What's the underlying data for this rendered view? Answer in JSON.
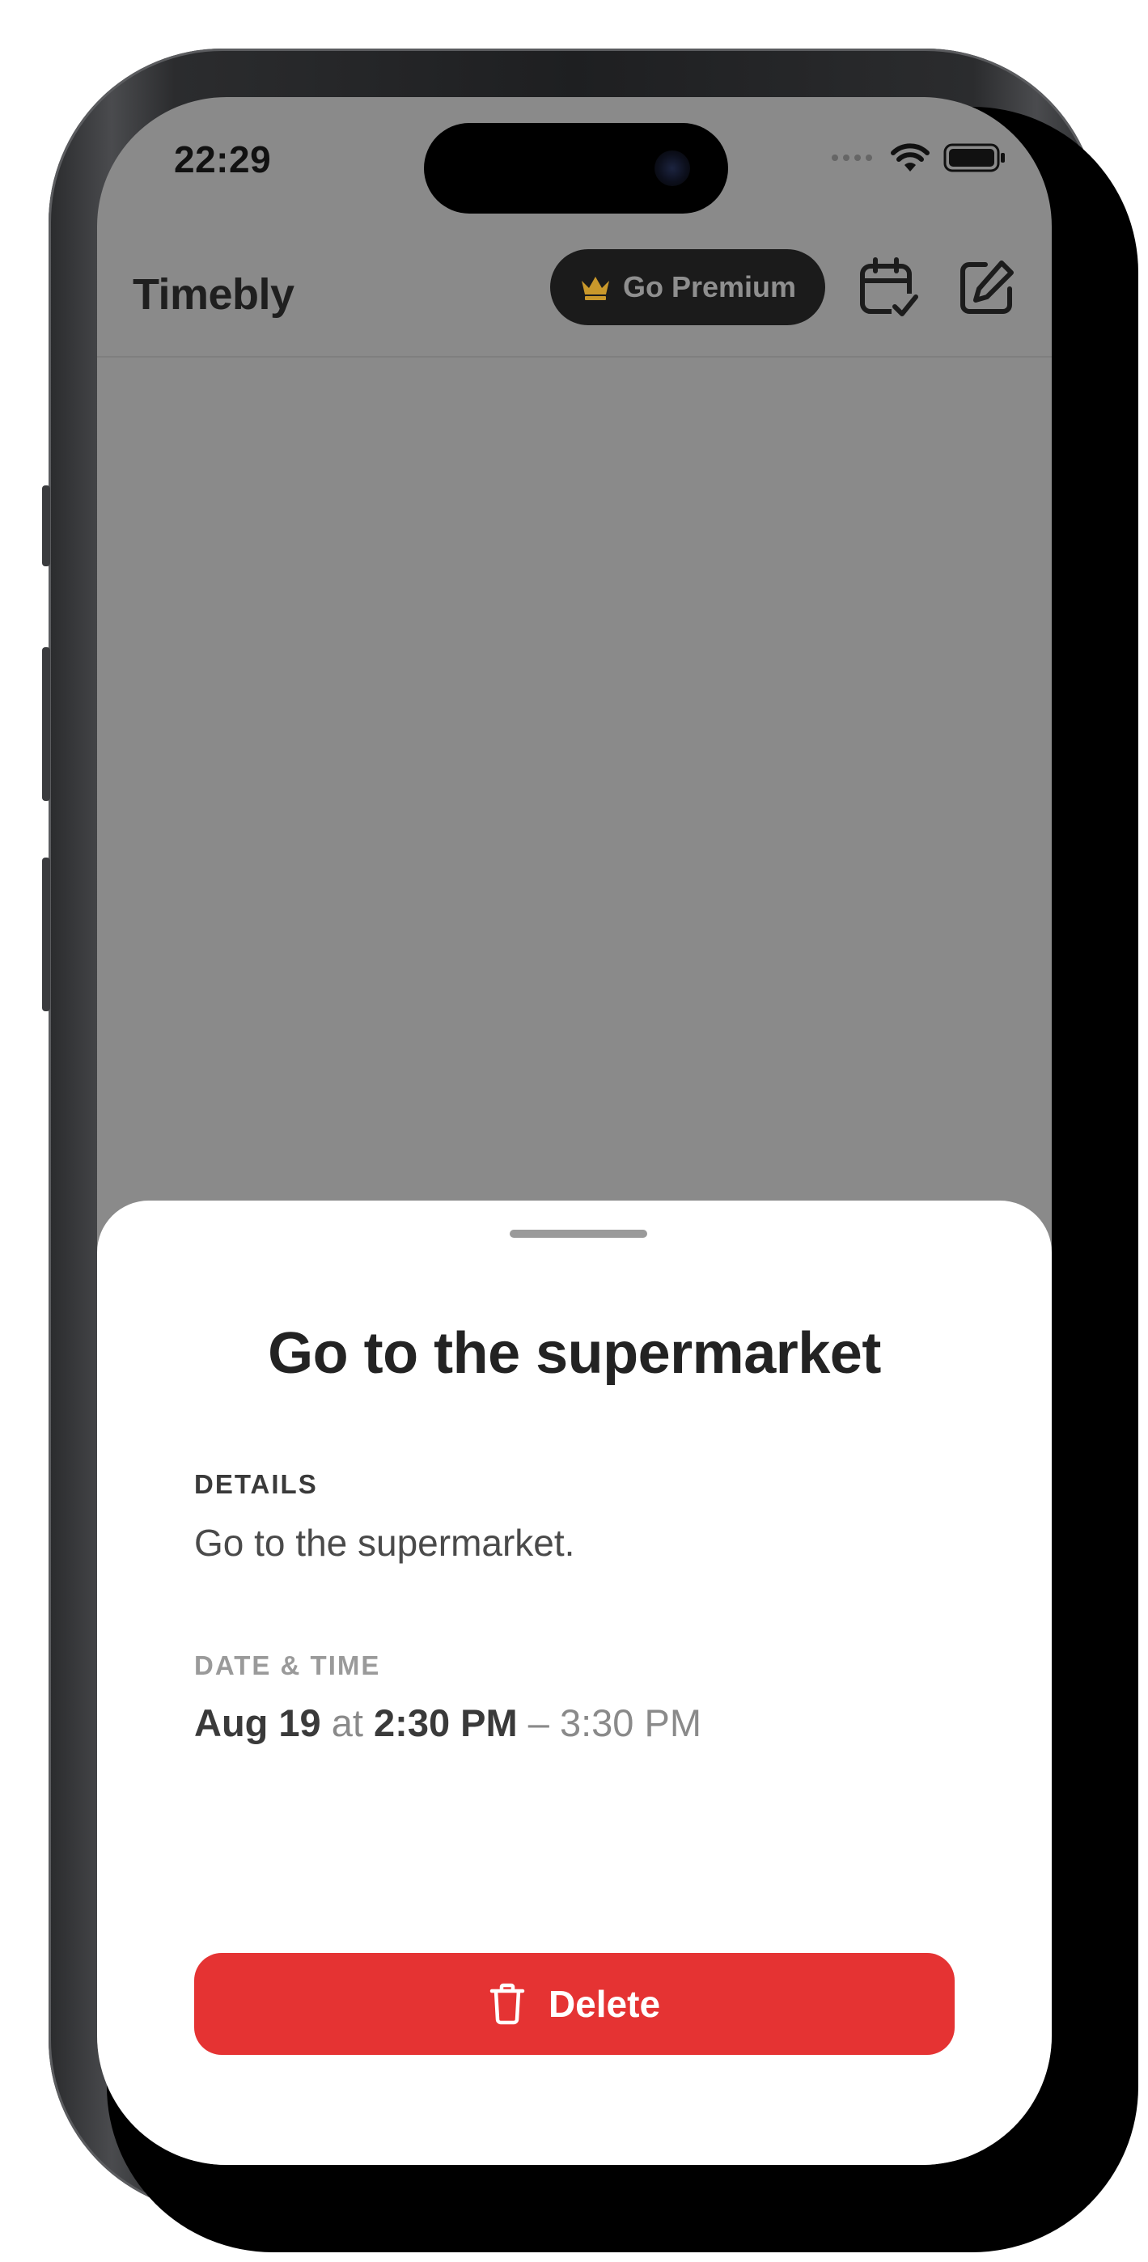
{
  "status_bar": {
    "time": "22:29"
  },
  "nav": {
    "app_title": "Timebly",
    "premium_label": "Go Premium",
    "icons": [
      "crown-icon",
      "calendar-check-icon",
      "compose-icon"
    ]
  },
  "sheet": {
    "title": "Go to the supermarket",
    "details_label": "DETAILS",
    "details_text": "Go to the supermarket.",
    "datetime_label": "DATE & TIME",
    "date": "Aug 19",
    "at": "at",
    "start_time": "2:30 PM",
    "dash": "–",
    "end_time": "3:30 PM",
    "delete_label": "Delete"
  },
  "colors": {
    "overlay": "#8a8a8a",
    "delete_red": "#e53333",
    "crown_gold": "#c9982b",
    "premium_bg": "#1b1b1b"
  }
}
